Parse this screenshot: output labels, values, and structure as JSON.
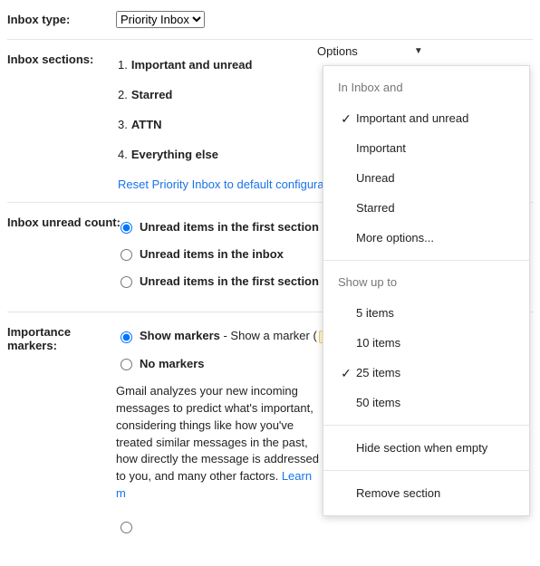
{
  "inbox_type": {
    "label": "Inbox type:",
    "selected": "Priority Inbox"
  },
  "inbox_sections": {
    "label": "Inbox sections:",
    "items": [
      {
        "num": "1.",
        "name": "Important and unread"
      },
      {
        "num": "2.",
        "name": "Starred"
      },
      {
        "num": "3.",
        "name": "ATTN"
      },
      {
        "num": "4.",
        "name": "Everything else"
      }
    ],
    "reset_link": "Reset Priority Inbox to default configura"
  },
  "options_trigger": "Options",
  "dropdown": {
    "header_inbox": "In Inbox and",
    "inbox_options": [
      {
        "label": "Important and unread",
        "checked": true
      },
      {
        "label": "Important",
        "checked": false
      },
      {
        "label": "Unread",
        "checked": false
      },
      {
        "label": "Starred",
        "checked": false
      },
      {
        "label": "More options...",
        "checked": false
      }
    ],
    "header_showup": "Show up to",
    "show_options": [
      {
        "label": "5 items",
        "checked": false
      },
      {
        "label": "10 items",
        "checked": false
      },
      {
        "label": "25 items",
        "checked": true
      },
      {
        "label": "50 items",
        "checked": false
      }
    ],
    "hide_when_empty": "Hide section when empty",
    "remove_section": "Remove section"
  },
  "unread_count": {
    "label": "Inbox unread count:",
    "options": [
      "Unread items in the first section",
      "Unread items in the inbox",
      "Unread items in the first section an"
    ],
    "selected_index": 0
  },
  "importance_markers": {
    "label": "Importance\nmarkers:",
    "options": [
      {
        "bold": "Show markers",
        "rest": " - Show a marker (",
        "after_chip": " )"
      },
      {
        "bold": "No markers",
        "rest": "",
        "after_chip": ""
      }
    ],
    "selected_index": 0,
    "description": "Gmail analyzes your new incoming messages to predict what's important, considering things like how you've treated similar messages in the past, how directly the message is addressed to you, and many other factors. ",
    "learn_more": "Learn m"
  }
}
